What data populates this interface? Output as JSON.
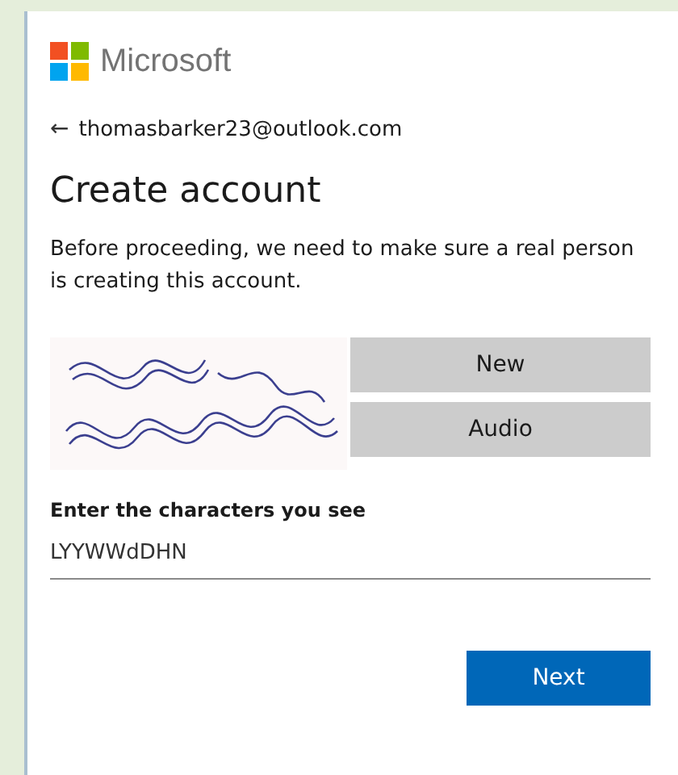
{
  "brand": {
    "name": "Microsoft"
  },
  "back": {
    "icon": "←",
    "email": "thomasbarker23@outlook.com"
  },
  "heading": "Create account",
  "intro": "Before proceeding, we need to make sure a real person is creating this account.",
  "captcha": {
    "kind": "picture",
    "buttons": [
      "New",
      "Audio"
    ]
  },
  "field": {
    "label": "Enter the characters you see",
    "value": "LYYWWdDHN"
  },
  "buttons": [
    "Next"
  ]
}
